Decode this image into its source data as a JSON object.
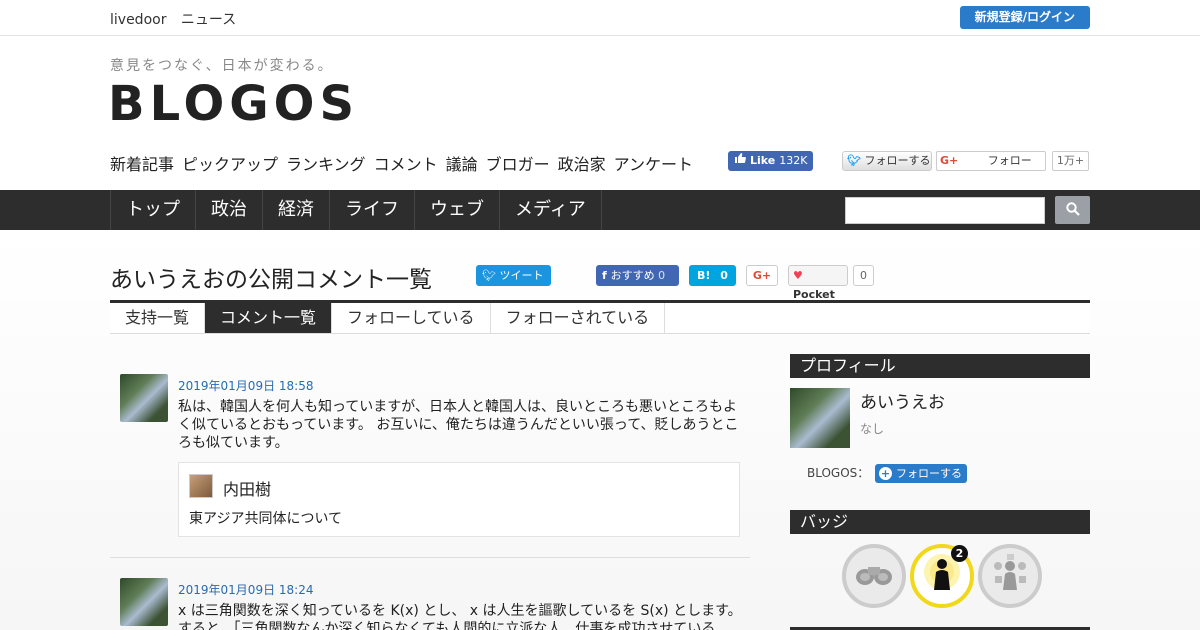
{
  "topbar": {
    "brand": [
      "livedoor",
      "ニュース"
    ],
    "login_label": "新規登録/ログイン"
  },
  "header": {
    "tagline": "意見をつなぐ、日本が変わる。",
    "logo": "BLOGOS",
    "subnav": [
      "新着記事",
      "ピックアップ",
      "ランキング",
      "コメント",
      "議論",
      "ブロガー",
      "政治家",
      "アンケート"
    ],
    "fb_like": {
      "label": "Like",
      "count": "132K"
    },
    "twitter_follow": "フォローする",
    "gplus_follow": "フォロー",
    "gplus_count": "1万+"
  },
  "mainnav": {
    "items": [
      "トップ",
      "政治",
      "経済",
      "ライフ",
      "ウェブ",
      "メディア"
    ],
    "search_placeholder": ""
  },
  "page": {
    "title": "あいうえおの公開コメント一覧",
    "share": {
      "tweet": "ツイート",
      "fb": "おすすめ",
      "fb_count": "0",
      "hatena": "B!",
      "hatena_count": "0",
      "gplus": "G+",
      "pocket": "Pocket",
      "pocket_count": "0"
    },
    "tabs": [
      {
        "label": "支持一覧",
        "active": false
      },
      {
        "label": "コメント一覧",
        "active": true
      },
      {
        "label": "フォローしている",
        "active": false
      },
      {
        "label": "フォローされている",
        "active": false
      }
    ]
  },
  "comments": [
    {
      "date": "2019年01月09日 18:58",
      "text": "私は、韓国人を何人も知っていますが、日本人と韓国人は、良いところも悪いところもよく似ているとおもっています。 お互いに、俺たちは違うんだといい張って、貶しあうところも似ています。",
      "ref_author": "内田樹",
      "ref_title": "東アジア共同体について"
    },
    {
      "date": "2019年01月09日 18:24",
      "text": "x は三角関数を深く知っているを K(x) とし、 x は人生を謳歌しているを S(x) とします。 すると、「三角関数なんか深く知らなくても人間的に立派な人、仕事を成功させている"
    }
  ],
  "sidebar": {
    "profile_heading": "プロフィール",
    "name": "あいうえお",
    "sub": "なし",
    "blogos_label": "BLOGOS：",
    "follow_label": "フォローする",
    "badge_heading": "バッジ",
    "badges": [
      {
        "icon": "binoculars-icon",
        "count": ""
      },
      {
        "icon": "person-broadcast-icon",
        "count": "2"
      },
      {
        "icon": "person-social-icon",
        "count": ""
      }
    ]
  },
  "colors": {
    "accent_blue": "#2a7bc9",
    "nav_dark": "#2d2d2d",
    "badge_gold": "#f2d81a"
  }
}
